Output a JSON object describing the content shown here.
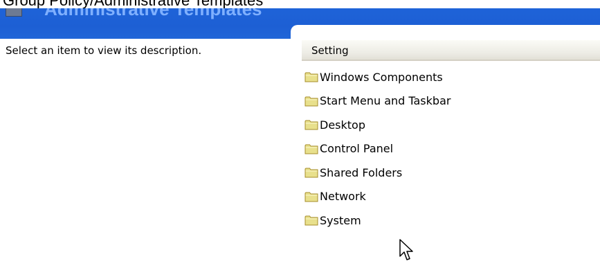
{
  "window": {
    "partial_heading": "Administrative Templates",
    "top_strip_text": "Group Policy/Administrative Templates"
  },
  "description_pane": {
    "text": "Select an item to view its description."
  },
  "list_view": {
    "column_header": "Setting",
    "items": [
      {
        "label": "Windows Components",
        "icon": "folder-icon"
      },
      {
        "label": "Start Menu and Taskbar",
        "icon": "folder-icon"
      },
      {
        "label": "Desktop",
        "icon": "folder-icon"
      },
      {
        "label": "Control Panel",
        "icon": "folder-icon"
      },
      {
        "label": "Shared Folders",
        "icon": "folder-icon"
      },
      {
        "label": "Network",
        "icon": "folder-icon"
      },
      {
        "label": "System",
        "icon": "folder-icon"
      }
    ]
  },
  "colors": {
    "banner": "#1d5fd4",
    "folder_fill": "#e8e08c",
    "folder_stroke": "#a68c2a"
  }
}
